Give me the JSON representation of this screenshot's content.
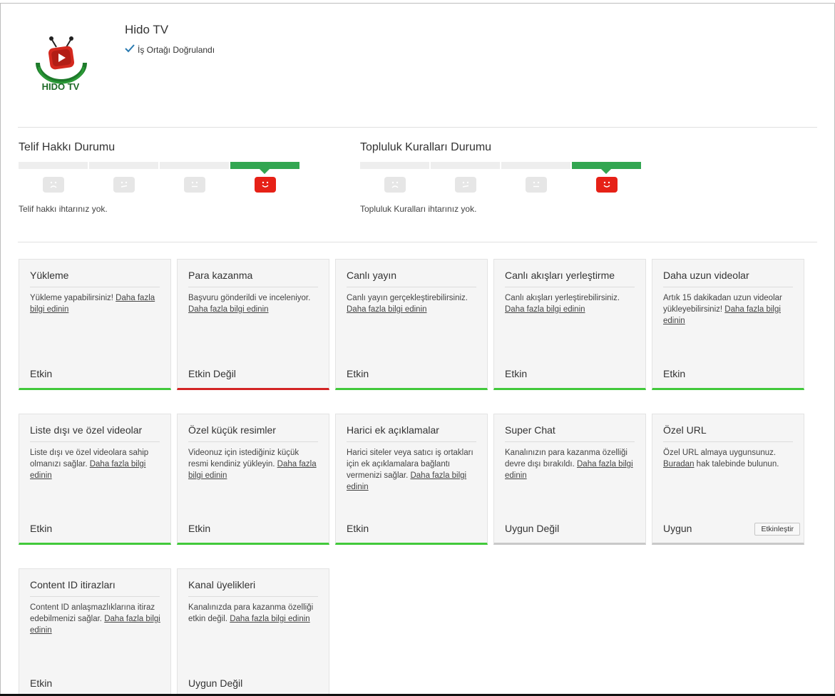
{
  "channel": {
    "name": "Hido TV",
    "verified_label": "İş Ortağı Doğrulandı",
    "logo_text": "HIDO TV"
  },
  "copyright": {
    "title": "Telif Hakkı Durumu",
    "message": "Telif hakkı ihtarınız yok.",
    "level": 4,
    "levels": 4
  },
  "community": {
    "title": "Topluluk Kuralları Durumu",
    "message": "Topluluk Kuralları ihtarınız yok.",
    "level": 4,
    "levels": 4
  },
  "colors": {
    "enabled": "#42c93b",
    "disabled": "#d32424",
    "neutral": "#c8c8c8",
    "active_segment": "#32a651",
    "happy_face": "#e62117"
  },
  "features": [
    {
      "title": "Yükleme",
      "desc": "Yükleme yapabilirsiniz! ",
      "link": "Daha fazla bilgi edinin",
      "desc_after": "",
      "status": "Etkin",
      "state": "green"
    },
    {
      "title": "Para kazanma",
      "desc": "Başvuru gönderildi ve inceleniyor. ",
      "link": "Daha fazla bilgi edinin",
      "desc_after": "",
      "status": "Etkin Değil",
      "state": "red"
    },
    {
      "title": "Canlı yayın",
      "desc": "Canlı yayın gerçekleştirebilirsiniz. ",
      "link": "Daha fazla bilgi edinin",
      "desc_after": "",
      "status": "Etkin",
      "state": "green"
    },
    {
      "title": "Canlı akışları yerleştirme",
      "desc": "Canlı akışları yerleştirebilirsiniz. ",
      "link": "Daha fazla bilgi edinin",
      "desc_after": "",
      "status": "Etkin",
      "state": "green"
    },
    {
      "title": "Daha uzun videolar",
      "desc": "Artık 15 dakikadan uzun videolar yükleyebilirsiniz! ",
      "link": "Daha fazla bilgi edinin",
      "desc_after": "",
      "status": "Etkin",
      "state": "green"
    },
    {
      "title": "Liste dışı ve özel videolar",
      "desc": "Liste dışı ve özel videolara sahip olmanızı sağlar. ",
      "link": "Daha fazla bilgi edinin",
      "desc_after": "",
      "status": "Etkin",
      "state": "green"
    },
    {
      "title": "Özel küçük resimler",
      "desc": "Videonuz için istediğiniz küçük resmi kendiniz yükleyin. ",
      "link": "Daha fazla bilgi edinin",
      "desc_after": "",
      "status": "Etkin",
      "state": "green"
    },
    {
      "title": "Harici ek açıklamalar",
      "desc": "Harici siteler veya satıcı iş ortakları için ek açıklamalara bağlantı vermenizi sağlar. ",
      "link": "Daha fazla bilgi edinin",
      "desc_after": "",
      "status": "Etkin",
      "state": "green"
    },
    {
      "title": "Super Chat",
      "desc": "Kanalınızın para kazanma özelliği devre dışı bırakıldı. ",
      "link": "Daha fazla bilgi edinin",
      "desc_after": "",
      "status": "Uygun Değil",
      "state": "neutral"
    },
    {
      "title": "Özel URL",
      "desc": "Özel URL almaya uygunsunuz. ",
      "link": "Buradan",
      "desc_after": " hak talebinde bulunun.",
      "status": "Uygun",
      "state": "neutral",
      "button": "Etkinleştir"
    },
    {
      "title": "Content ID itirazları",
      "desc": "Content ID anlaşmazlıklarına itiraz edebilmenizi sağlar. ",
      "link": "Daha fazla bilgi edinin",
      "desc_after": "",
      "status": "Etkin",
      "state": "green"
    },
    {
      "title": "Kanal üyelikleri",
      "desc": "Kanalınızda para kazanma özelliği etkin değil. ",
      "link": "Daha fazla bilgi edinin",
      "desc_after": "",
      "status": "Uygun Değil",
      "state": "neutral"
    }
  ]
}
